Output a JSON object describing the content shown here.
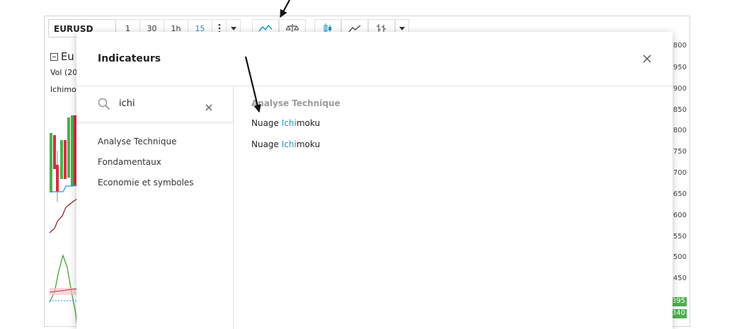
{
  "toolbar": {
    "symbol": "EURUSD",
    "intervals": [
      "1",
      "30",
      "1h",
      "15"
    ],
    "active_interval": "15"
  },
  "chart": {
    "legend_title": "Eu",
    "legend_vol": "Vol (20",
    "legend_ichimoku": "Ichimo",
    "price_axis_labels": [
      "800",
      "950",
      "900",
      "850",
      "800",
      "750",
      "700",
      "650",
      "600",
      "550",
      "500",
      "450"
    ],
    "price_tags": [
      "395",
      "340"
    ],
    "colors": {
      "bull": "#4caf50",
      "bear": "#d32f3f",
      "line_blue": "#2196f3",
      "line_dark_red": "#8b1a1a",
      "line_green": "#3a9b2a"
    }
  },
  "modal": {
    "title": "Indicateurs",
    "search_value": "ichi",
    "search_placeholder": "",
    "categories": [
      "Analyse Technique",
      "Fondamentaux",
      "Economie et symboles"
    ],
    "results_heading": "Analyse Technique",
    "results": [
      {
        "before": "Nuage ",
        "highlight": "Ichi",
        "after": "moku"
      },
      {
        "before": "Nuage ",
        "highlight": "Ichi",
        "after": "moku"
      }
    ]
  },
  "icons": [
    "search-icon",
    "clear-icon",
    "close-icon",
    "indicators-icon",
    "compare-icon",
    "candles-icon",
    "chevron-down-icon"
  ]
}
